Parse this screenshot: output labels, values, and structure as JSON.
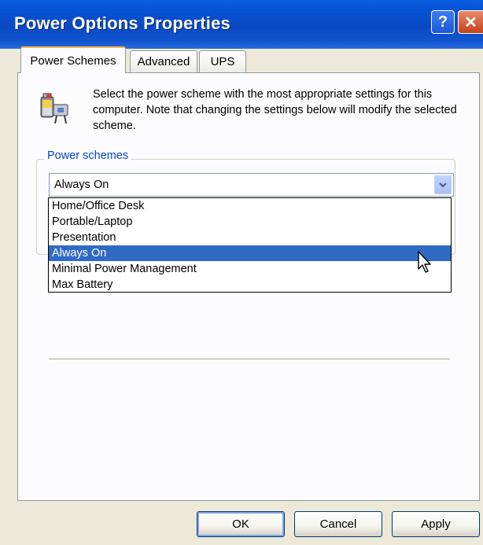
{
  "window": {
    "title": "Power Options Properties",
    "help_button": "?",
    "close_button": "✕"
  },
  "tabs": [
    {
      "label": "Power Schemes",
      "active": true
    },
    {
      "label": "Advanced",
      "active": false
    },
    {
      "label": "UPS",
      "active": false
    }
  ],
  "description": "Select the power scheme with the most appropriate settings for this computer. Note that changing the settings below will modify the selected scheme.",
  "power_schemes": {
    "group_label": "Power schemes",
    "selected": "Always On",
    "options": [
      "Home/Office Desk",
      "Portable/Laptop",
      "Presentation",
      "Always On",
      "Minimal Power Management",
      "Max Battery"
    ],
    "highlighted_option": "Always On"
  },
  "buttons": {
    "ok": "OK",
    "cancel": "Cancel",
    "apply": "Apply"
  },
  "colors": {
    "title_bar": "#0a49c4",
    "selection": "#316ac5",
    "group_label": "#0046d5",
    "dialog_background": "#ece9d8"
  },
  "icons": {
    "scheme_icon": "power-options-icon",
    "dropdown": "chevron-down-icon",
    "pointer": "mouse-cursor-icon"
  }
}
